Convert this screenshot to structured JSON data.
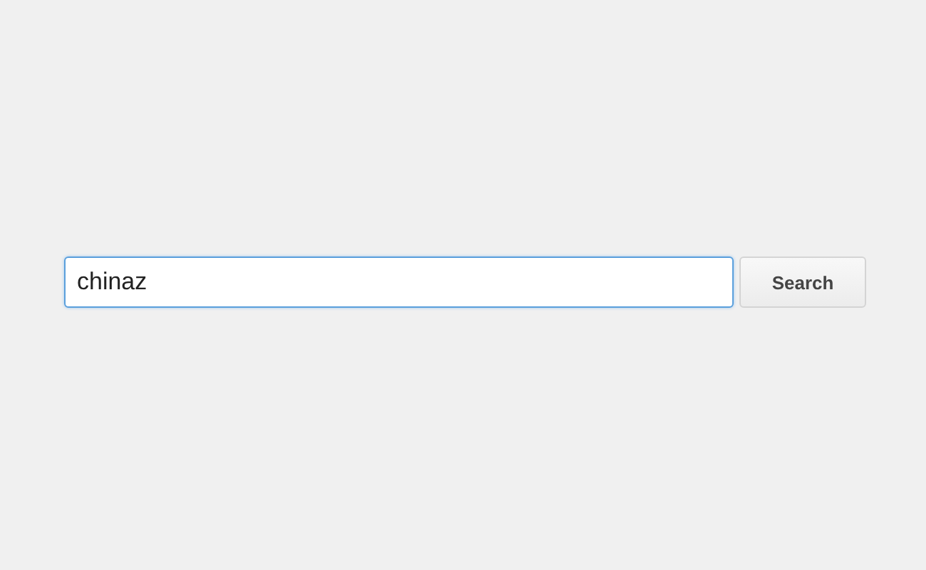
{
  "search": {
    "value": "chinaz"
  },
  "button": {
    "label": "Search"
  }
}
